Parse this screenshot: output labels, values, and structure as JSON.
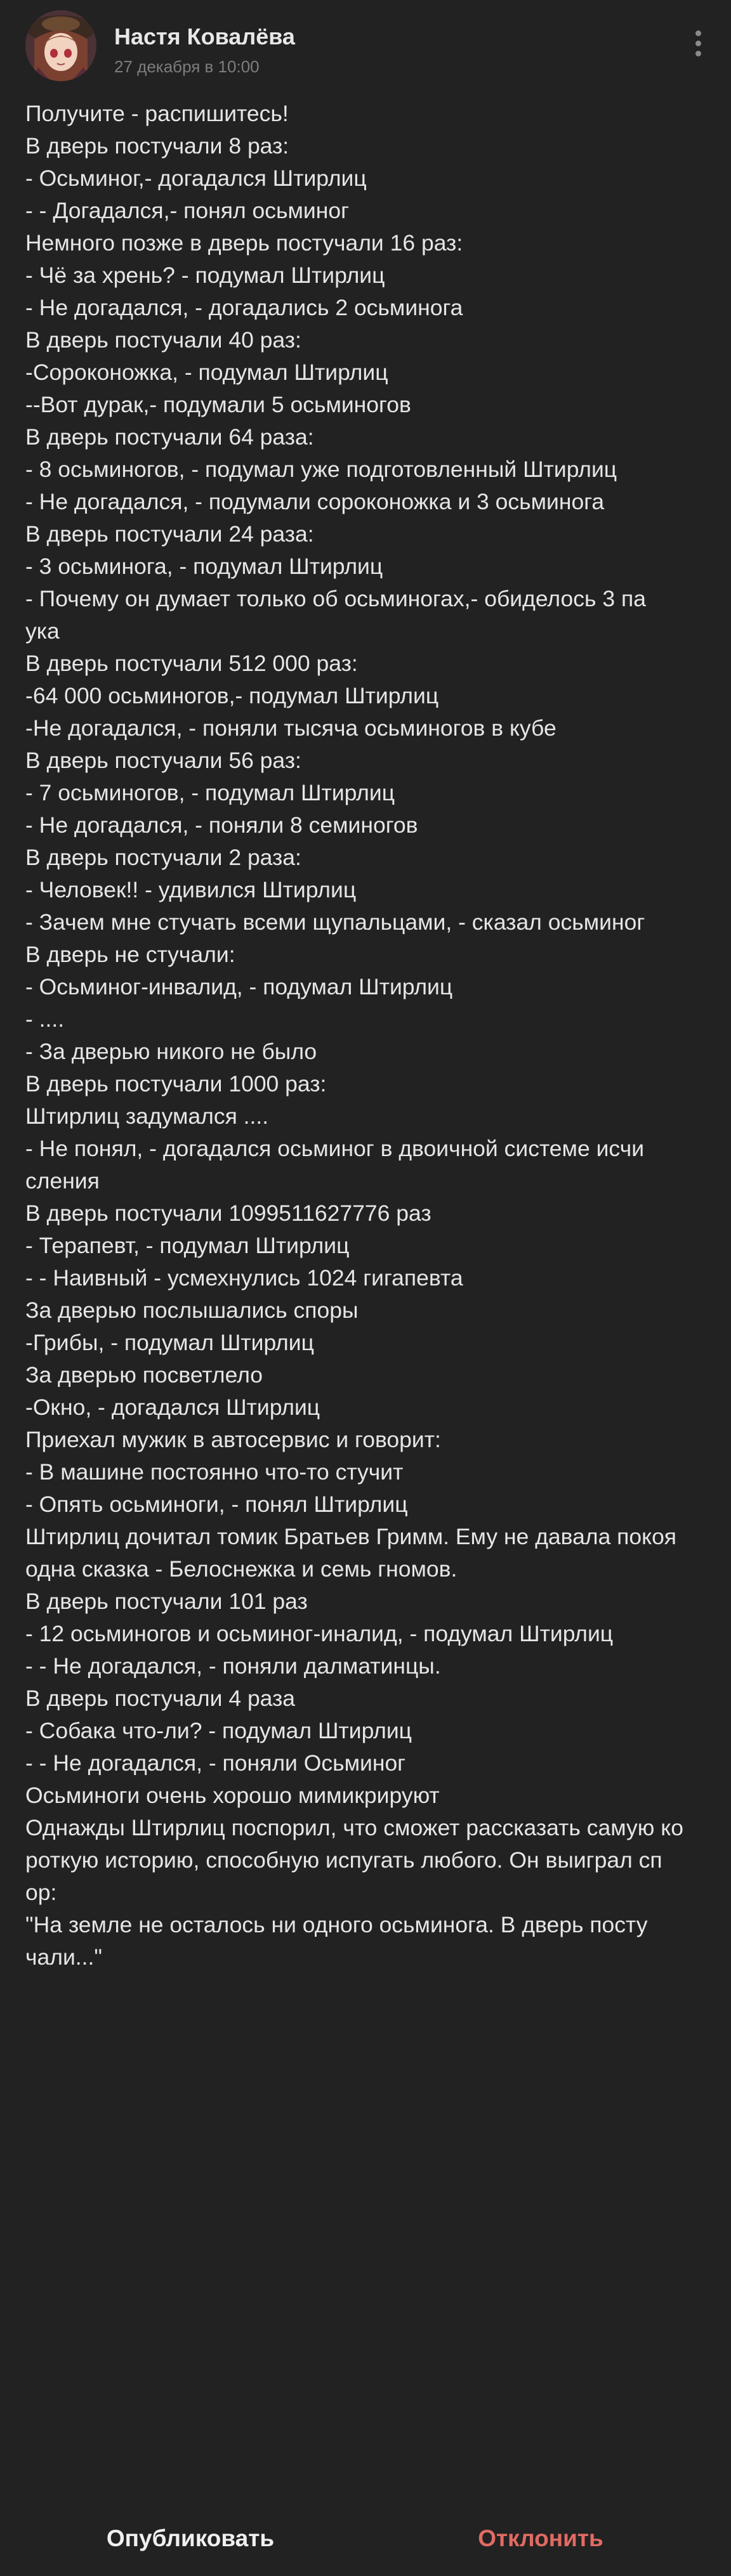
{
  "post": {
    "author_name": "Настя Ковалёва",
    "date": "27 декабря в 10:00",
    "lines": [
      "Получите - распишитесь!",
      "В дверь постучали 8 раз:",
      "- Осьминог,- догадался Штирлиц",
      "- - Догадался,- понял осьминог",
      "Немного позже в дверь постучали 16 раз:",
      "- Чё за хрень? - подумал Штирлиц",
      "- Не догадался, - догадались 2 осьминога",
      "В дверь постучали 40 раз:",
      "-Сороконожка, - подумал Штирлиц",
      "--Вот дурак,- подумали 5 осьминогов",
      "В дверь постучали 64 раза:",
      "- 8 осьминогов, - подумал уже подготовленный Штирлиц",
      "- Не догадался, - подумали сороконожка и 3 осьминога",
      "В дверь постучали 24 раза:",
      "- 3 осьминога, - подумал Штирлиц",
      "- Почему он думает только об осьминогах,- обиделось 3 па",
      "ука",
      "В дверь постучали 512 000 раз:",
      "-64 000 осьминогов,- подумал Штирлиц",
      "-Не догадался, - поняли тысяча осьминогов в кубе",
      "В дверь постучали 56 раз:",
      "- 7 осьминогов, - подумал Штирлиц",
      "- Не догадался, - поняли 8 семиногов",
      "В дверь постучали 2 раза:",
      "- Человек!! - удивился Штирлиц",
      "- Зачем мне стучать всеми щупальцами, - сказал осьминог",
      "В дверь не стучали:",
      "- Осьминог-инвалид, - подумал Штирлиц",
      "- ....",
      "- За дверью никого не было",
      "В дверь постучали 1000 раз:",
      "Штирлиц задумался ....",
      "- Не понял, - догадался осьминог в двоичной системе исчи",
      "сления",
      "В дверь постучали 1099511627776 раз",
      "- Терапевт, - подумал Штирлиц",
      "- - Наивный - усмехнулись 1024 гигапевта",
      "За дверью послышались споры",
      "-Грибы, - подумал Штирлиц",
      "За дверью посветлело",
      "-Окно, - догадался Штирлиц",
      "Приехал мужик в автосервис и говорит:",
      "- В машине постоянно что-то стучит",
      "- Опять осьминоги, - понял Штирлиц",
      "Штирлиц дочитал томик Братьев Гримм. Ему не давала покоя",
      "одна сказка - Белоснежка и семь гномов.",
      "В дверь постучали 101 раз",
      "- 12 осьминогов и осьминог-иналид, - подумал Штирлиц",
      "- - Не догадался, - поняли далматинцы.",
      "В дверь постучали 4 раза",
      "- Собака что-ли? - подумал Штирлиц",
      "- - Не догадался, - поняли Осьминог",
      "Осьминоги очень хорошо мимикрируют",
      "Однажды Штирлиц поспорил, что сможет рассказать самую ко",
      "роткую историю, способную испугать любого. Он выиграл сп",
      "ор:",
      "\"На земле не осталось ни одного осьминога. В дверь посту",
      "чали...\""
    ]
  },
  "footer": {
    "publish_label": "Опубликовать",
    "reject_label": "Отклонить"
  },
  "colors": {
    "background": "#222222",
    "text": "#e6e6e6",
    "date": "#7d7d7d",
    "reject": "#e06b62"
  },
  "icons": {
    "avatar": "avatar-anime-girl",
    "more": "more-vertical-icon"
  }
}
